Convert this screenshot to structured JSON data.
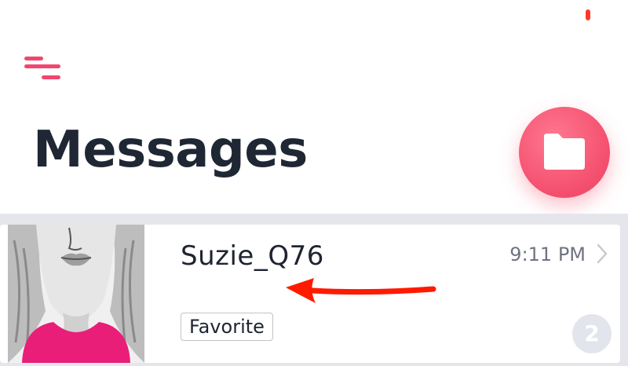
{
  "header": {
    "menu_icon": "menu-icon",
    "title": "Messages",
    "folder_icon": "folder-icon"
  },
  "conversations": [
    {
      "name": "Suzie_Q76",
      "time": "9:11 PM",
      "tag": "Favorite",
      "unread": "2"
    }
  ],
  "colors": {
    "accent": "#f34e6d",
    "title": "#1e2733",
    "list_bg": "#e4e6ec",
    "annotation_arrow": "#ff1a00"
  }
}
